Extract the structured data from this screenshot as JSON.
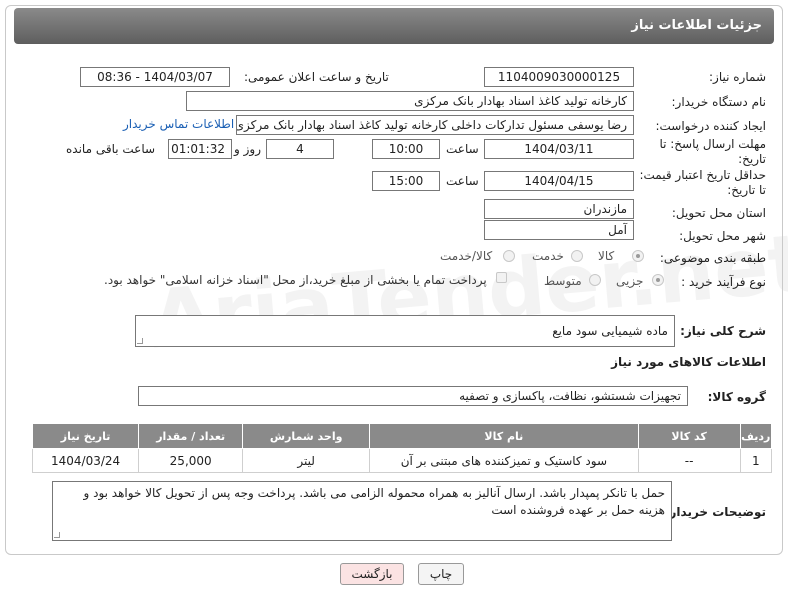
{
  "header": {
    "title": "جزئیات اطلاعات نیاز"
  },
  "fields": {
    "need_number": {
      "label": "شماره نیاز:",
      "value": "1104009030000125"
    },
    "announce_datetime": {
      "label": "تاریخ و ساعت اعلان عمومی:",
      "value": "1404/03/07 - 08:36"
    },
    "buyer_org": {
      "label": "نام دستگاه خریدار:",
      "value": "کارخانه تولید کاغذ اسناد بهادار بانک مرکزی"
    },
    "requester": {
      "label": "ایجاد کننده درخواست:",
      "value": "رضا یوسفی مسئول تداركات داخلی کارخانه تولید کاغذ اسناد بهادار بانک مرکزی",
      "contact_link": "اطلاعات تماس خریدار"
    },
    "reply_deadline": {
      "label_line1": "مهلت ارسال پاسخ: تا",
      "label_line2": "تاریخ:",
      "date": "1404/03/11",
      "time_label": "ساعت",
      "time": "10:00",
      "days": "4",
      "days_label": "روز و",
      "remaining": "01:01:32",
      "remaining_label": "ساعت باقی مانده"
    },
    "price_validity": {
      "label_line1": "حداقل تاریخ اعتبار قیمت:",
      "label_line2": "تا تاریخ:",
      "date": "1404/04/15",
      "time_label": "ساعت",
      "time": "15:00"
    },
    "province": {
      "label": "استان محل تحویل:",
      "value": "مازندران"
    },
    "city": {
      "label": "شهر محل تحویل:",
      "value": "آمل"
    },
    "category": {
      "label": "طبقه بندی موضوعی:",
      "options": [
        "کالا",
        "خدمت",
        "کالا/خدمت"
      ],
      "selected": "کالا"
    },
    "process": {
      "label": "نوع فرآیند خرید :",
      "options": [
        "جزیی",
        "متوسط"
      ],
      "note": "پرداخت تمام یا بخشی از مبلغ خرید،از محل \"اسناد خزانه اسلامی\" خواهد بود."
    }
  },
  "description": {
    "label": "شرح کلی نیاز:",
    "value": "ماده شیمیایی سود مایع"
  },
  "goods_section": {
    "title": "اطلاعات کالاهای مورد نیاز",
    "group_label": "گروه کالا:",
    "group_value": "تجهیزات شستشو، نظافت، پاکسازی و تصفیه"
  },
  "table": {
    "headers": [
      "ردیف",
      "کد کالا",
      "نام کالا",
      "واحد شمارش",
      "تعداد / مقدار",
      "تاریخ نیاز"
    ],
    "rows": [
      [
        "1",
        "--",
        "سود کاستیک و تمیزکننده های مبتنی بر آن",
        "لیتر",
        "25,000",
        "1404/03/24"
      ]
    ]
  },
  "buyer_notes": {
    "label": "توضیحات خریدار:",
    "value": "حمل با تانکر پمپدار باشد. ارسال آنالیز به همراه محموله الزامی می باشد. پرداخت وجه پس از تحویل کالا خواهد بود و هزینه حمل بر عهده فروشنده است"
  },
  "buttons": {
    "print": "چاپ",
    "back": "بازگشت"
  },
  "colors": {
    "header_bg": "#6e6e6e",
    "link": "#1a5fb4",
    "back_button_bg": "#fbe3e3"
  },
  "watermark": "AriaTender.net"
}
